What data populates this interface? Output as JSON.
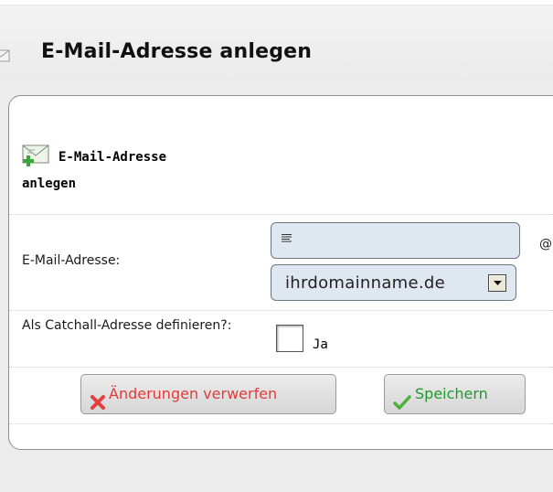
{
  "header": {
    "title": "E-Mail-Adresse anlegen",
    "icon": "envelope-icon"
  },
  "form": {
    "title": "E-Mail-Adresse anlegen",
    "title_icon": "envelope-add-icon",
    "email": {
      "label": "E-Mail-Adresse:",
      "value": "",
      "at": "@",
      "domain_selected": "ihrdomainname.de"
    },
    "catchall": {
      "label": "Als Catchall-Adresse definieren?:",
      "checked": false,
      "option_label": "Ja"
    },
    "buttons": {
      "discard": "Änderungen verwerfen",
      "save": "Speichern"
    }
  },
  "colors": {
    "discard_text": "#e23a3a",
    "save_text": "#1f9a2e",
    "input_bg": "#dfe8f1"
  }
}
